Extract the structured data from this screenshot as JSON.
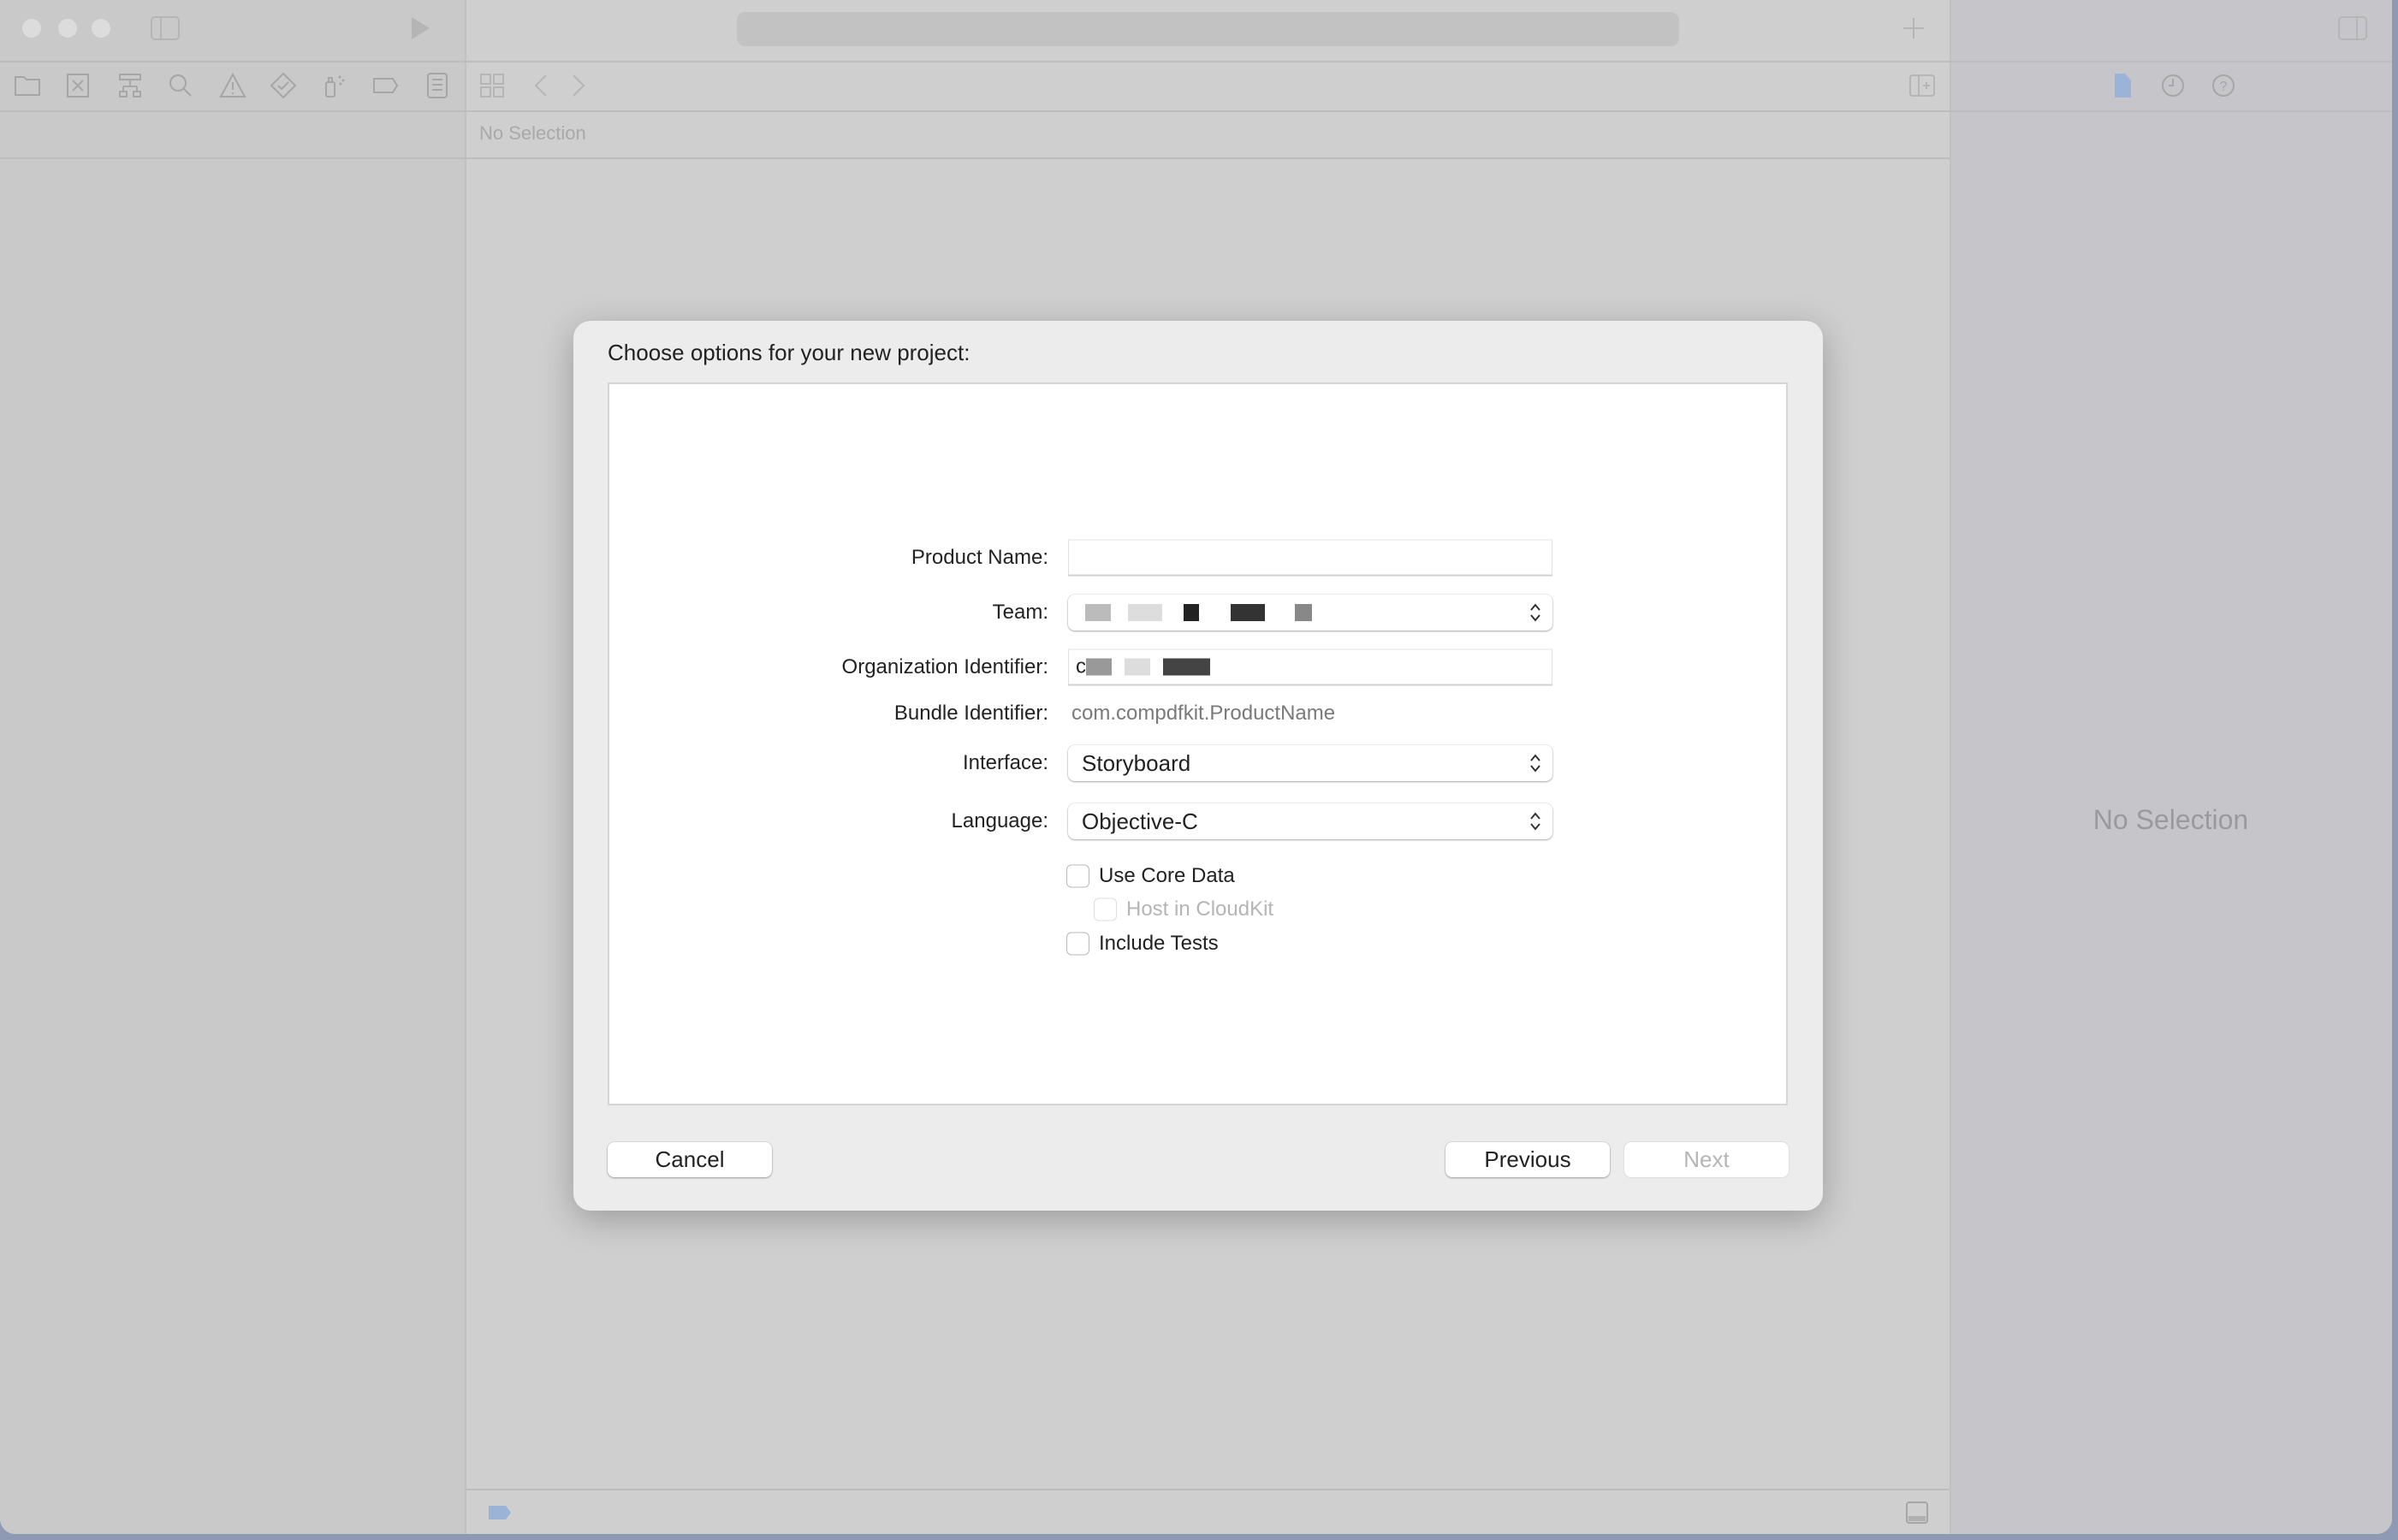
{
  "editor": {
    "no_selection": "No Selection"
  },
  "inspector": {
    "no_selection": "No Selection"
  },
  "dialog": {
    "title": "Choose options for your new project:",
    "fields": {
      "product_name": {
        "label": "Product Name:",
        "value": ""
      },
      "team": {
        "label": "Team:",
        "value": "(redacted)"
      },
      "org_identifier": {
        "label": "Organization Identifier:",
        "value_prefix": "c"
      },
      "bundle_identifier": {
        "label": "Bundle Identifier:",
        "value": "com.compdfkit.ProductName"
      },
      "interface": {
        "label": "Interface:",
        "value": "Storyboard"
      },
      "language": {
        "label": "Language:",
        "value": "Objective-C"
      }
    },
    "checkboxes": {
      "use_core_data": {
        "label": "Use Core Data",
        "checked": false
      },
      "host_in_cloudkit": {
        "label": "Host in CloudKit",
        "checked": false,
        "disabled": true
      },
      "include_tests": {
        "label": "Include Tests",
        "checked": false
      }
    },
    "buttons": {
      "cancel": "Cancel",
      "previous": "Previous",
      "next": "Next"
    }
  },
  "colors": {
    "accent": "#9cb3d8",
    "icon": "#a6a6a6"
  }
}
